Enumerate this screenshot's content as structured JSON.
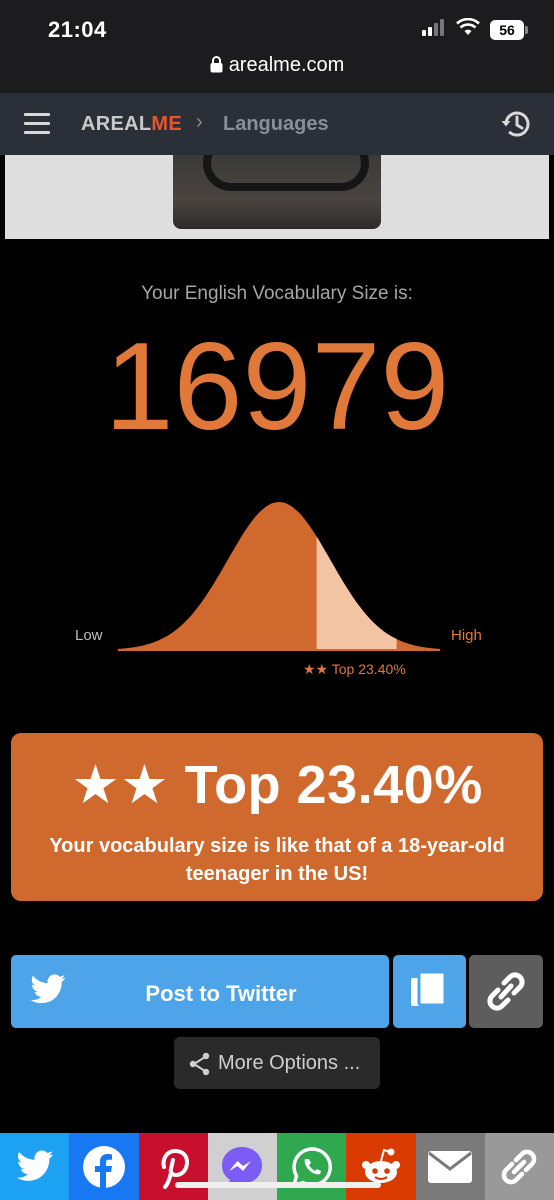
{
  "status_bar": {
    "time": "21:04",
    "battery": "56"
  },
  "browser": {
    "url": "arealme.com"
  },
  "nav": {
    "logo_part1": "AREAL",
    "logo_part2": "ME",
    "separator": "›",
    "breadcrumb": "Languages"
  },
  "result": {
    "label": "Your English Vocabulary Size is:",
    "score": "16979",
    "curve_low": "Low",
    "curve_high": "High",
    "curve_rank": "★★ Top 23.40%",
    "top_fraction": 0.234,
    "rank_title": "★★ Top 23.40%",
    "description": "Your vocabulary size is like that of a 18-year-old teenager in the US!"
  },
  "actions": {
    "twitter": "Post to Twitter",
    "more": "More Options ..."
  },
  "share_bar": [
    {
      "name": "twitter-icon",
      "color": "#1da1f2"
    },
    {
      "name": "facebook-icon",
      "color": "#1877f2"
    },
    {
      "name": "pinterest-icon",
      "color": "#c8102e"
    },
    {
      "name": "messenger-icon",
      "color": "#d0d0d0"
    },
    {
      "name": "whatsapp-icon",
      "color": "#2fa84f"
    },
    {
      "name": "reddit-icon",
      "color": "#d93a00"
    },
    {
      "name": "email-icon",
      "color": "#7a7a7a"
    },
    {
      "name": "link-icon",
      "color": "#999999"
    }
  ],
  "colors": {
    "accent": "#e0783a",
    "box": "#d0692e",
    "twitter_button": "#4da4e8",
    "navbar": "#2b3038"
  }
}
